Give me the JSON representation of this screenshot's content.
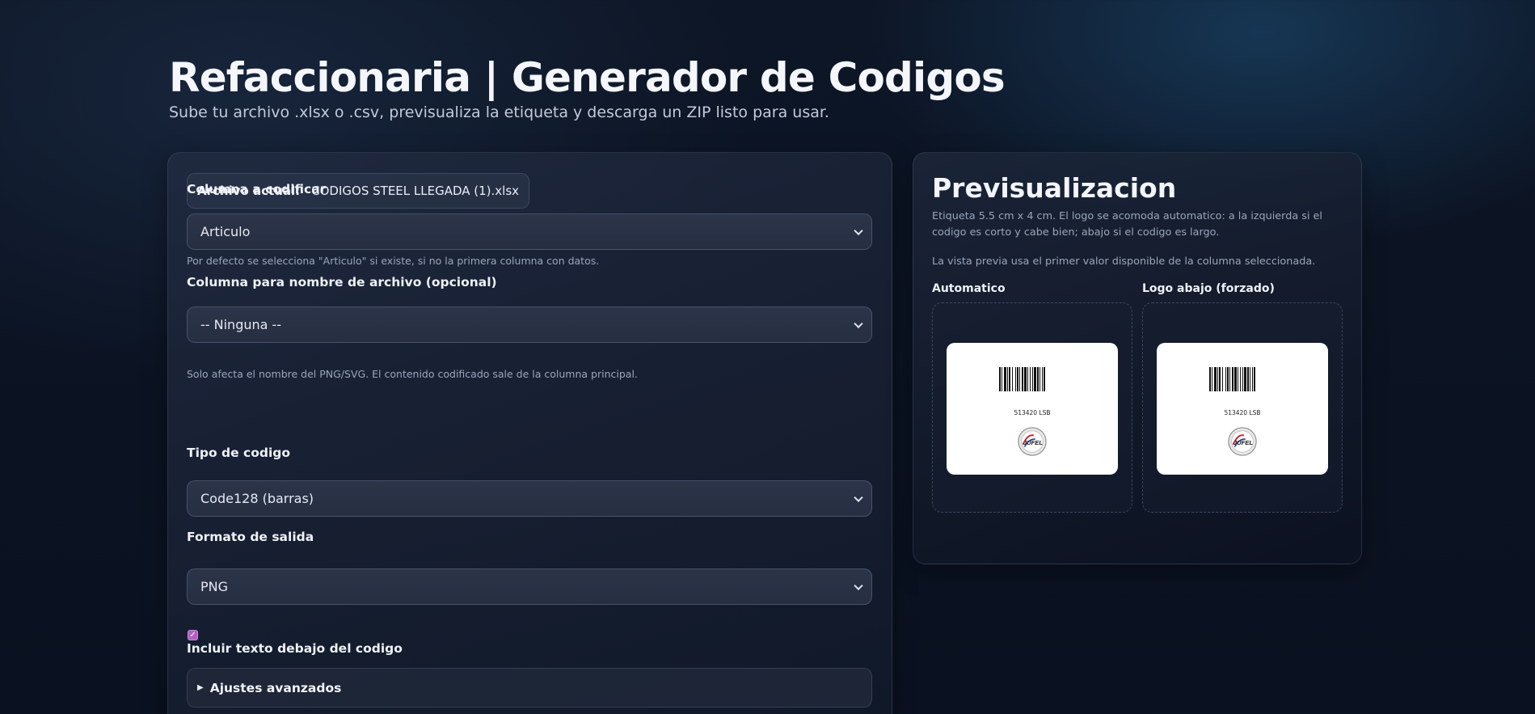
{
  "header": {
    "title": "Refaccionaria | Generador de Codigos",
    "subtitle": "Sube tu archivo .xlsx o .csv, previsualiza la etiqueta y descarga un ZIP listo para usar."
  },
  "form": {
    "file": {
      "label": "Archivo actual:",
      "value": "CODIGOS STEEL LLEGADA (1).xlsx"
    },
    "column": {
      "label": "Columna a codificar",
      "selected": "Articulo",
      "hint": "Por defecto se selecciona \"Articulo\" si existe, si no la primera columna con datos."
    },
    "filename_column": {
      "label": "Columna para nombre de archivo (opcional)",
      "selected": "-- Ninguna --",
      "hint": "Solo afecta el nombre del PNG/SVG. El contenido codificado sale de la columna principal."
    },
    "code_type": {
      "label": "Tipo de codigo",
      "selected": "Code128 (barras)"
    },
    "output_format": {
      "label": "Formato de salida",
      "selected": "PNG"
    },
    "include_text": {
      "label": "Incluir texto debajo del codigo",
      "checked": true
    },
    "advanced": {
      "label": "Ajustes avanzados"
    }
  },
  "preview": {
    "title": "Previsualizacion",
    "description": "Etiqueta 5.5 cm x 4 cm. El logo se acomoda automatico: a la izquierda si el codigo es corto y cabe bien; abajo si el codigo es largo.",
    "note": "La vista previa usa el primer valor disponible de la columna seleccionada.",
    "columns": [
      {
        "label": "Automatico",
        "code": "513420 LSB",
        "logo": "JUFEL"
      },
      {
        "label": "Logo abajo (forzado)",
        "code": "513420 LSB",
        "logo": "JUFEL"
      }
    ]
  },
  "colors": {
    "accent": "#b45ec4",
    "background": "#0b1322",
    "card": "#1f2a40"
  },
  "icons": {
    "select_chevron": "chevron-down-icon",
    "advanced_toggle": "triangle-right-icon",
    "checkbox": "check-icon"
  }
}
